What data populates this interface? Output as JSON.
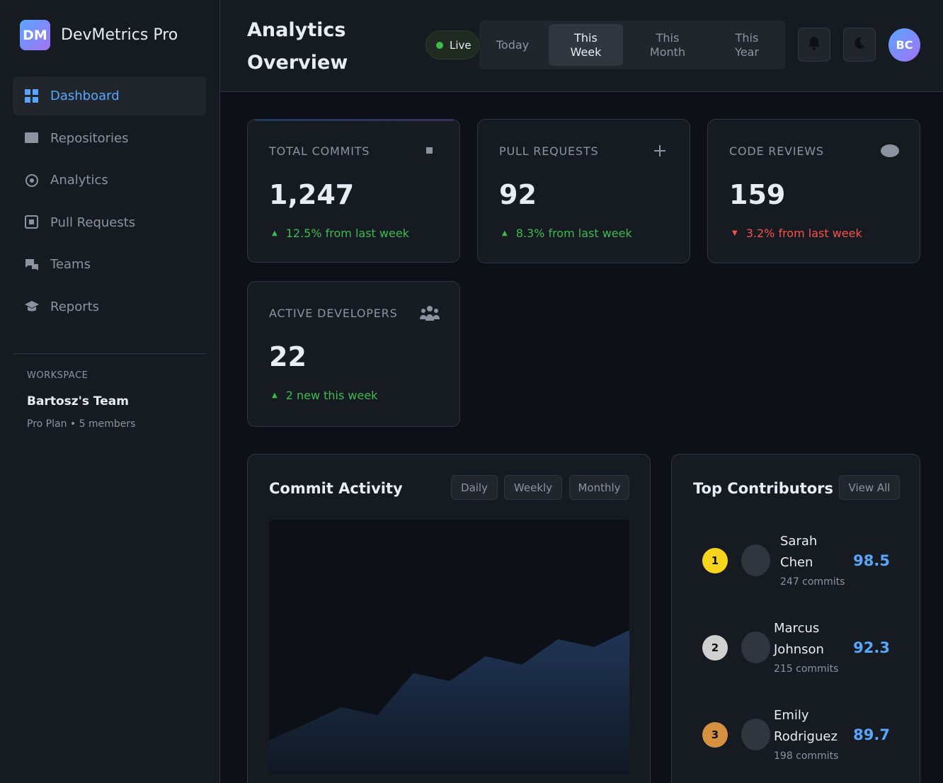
{
  "brand": {
    "logo": "DM",
    "name": "DevMetrics Pro"
  },
  "sidebar": {
    "items": [
      {
        "label": "Dashboard",
        "icon": "grid-icon",
        "active": true
      },
      {
        "label": "Repositories",
        "icon": "folder-icon",
        "active": false
      },
      {
        "label": "Analytics",
        "icon": "target-icon",
        "active": false
      },
      {
        "label": "Pull Requests",
        "icon": "square-dot-icon",
        "active": false
      },
      {
        "label": "Teams",
        "icon": "chat-icon",
        "active": false
      },
      {
        "label": "Reports",
        "icon": "graduation-cap-icon",
        "active": false
      }
    ],
    "workspace": {
      "label": "WORKSPACE",
      "name": "Bartosz's Team",
      "meta": "Pro Plan • 5 members"
    }
  },
  "header": {
    "title": "Analytics Overview",
    "live": "Live",
    "ranges": [
      {
        "label": "Today",
        "active": false
      },
      {
        "label": "This Week",
        "active": true
      },
      {
        "label": "This Month",
        "active": false
      },
      {
        "label": "This Year",
        "active": false
      }
    ],
    "avatar": "BC"
  },
  "stats": [
    {
      "label": "TOTAL COMMITS",
      "icon": "square-icon",
      "value": "1,247",
      "change": "12.5% from last week",
      "trend": "up"
    },
    {
      "label": "PULL REQUESTS",
      "icon": "plus-icon",
      "value": "92",
      "change": "8.3% from last week",
      "trend": "up"
    },
    {
      "label": "CODE REVIEWS",
      "icon": "eye-icon",
      "value": "159",
      "change": "3.2% from last week",
      "trend": "down"
    },
    {
      "label": "ACTIVE DEVELOPERS",
      "icon": "users-icon",
      "value": "22",
      "change": "2 new this week",
      "trend": "up"
    }
  ],
  "activity": {
    "title": "Commit Activity",
    "tabs": [
      "Daily",
      "Weekly",
      "Monthly"
    ]
  },
  "contributors": {
    "title": "Top Contributors",
    "view_all": "View All",
    "items": [
      {
        "rank": "1",
        "first": "Sarah",
        "last": "Chen",
        "commits": "247 commits",
        "score": "98.5",
        "color": "#f7d51d"
      },
      {
        "rank": "2",
        "first": "Marcus",
        "last": "Johnson",
        "commits": "215 commits",
        "score": "92.3",
        "color": "#d0d0d0"
      },
      {
        "rank": "3",
        "first": "Emily",
        "last": "Rodriguez",
        "commits": "198 commits",
        "score": "89.7",
        "color": "#d7903f"
      }
    ]
  },
  "colors": {
    "accent": "#58a6ff",
    "up": "#3fb950",
    "down": "#f85149",
    "background": "#0d1117",
    "surface": "#161b22"
  }
}
